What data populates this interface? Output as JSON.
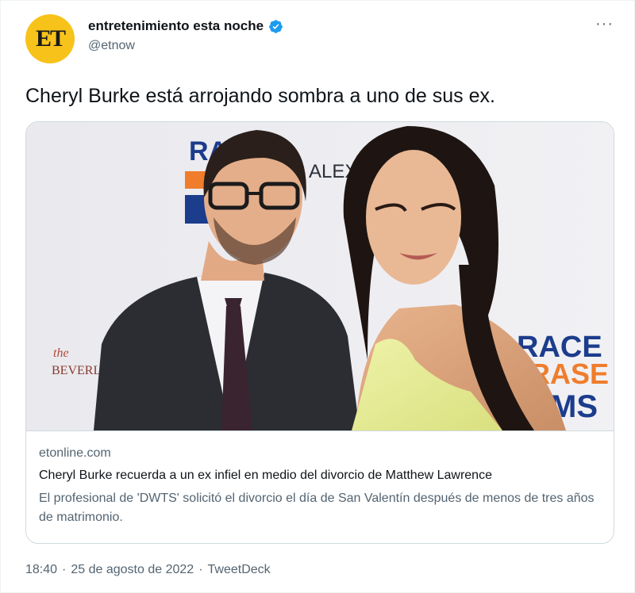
{
  "account": {
    "avatar_text": "ET",
    "display_name": "entretenimiento esta noche",
    "handle": "@etnow"
  },
  "tweet": {
    "text": "Cheryl Burke está arrojando sombra a uno de sus ex.",
    "more_label": "···"
  },
  "card": {
    "image_text": {
      "backdrop_left": "RACE",
      "backdrop_alex": "ALEX",
      "backdrop_right_1": "RACE",
      "backdrop_right_2": "ERASE",
      "backdrop_right_3": "MS",
      "beverly_the": "the",
      "beverly_name": "BEVERLY"
    },
    "domain": "etonline.com",
    "title": "Cheryl Burke recuerda a un ex infiel en medio del divorcio de Matthew Lawrence",
    "description": "El profesional de 'DWTS' solicitó el divorcio el día de San Valentín después de menos de tres años de matrimonio."
  },
  "footer": {
    "time": "18:40",
    "separator1": "·",
    "date": "25 de agosto de 2022",
    "separator2": "·",
    "app": "TweetDeck"
  },
  "colors": {
    "avatar_bg": "#f7c21a",
    "verified": "#1d9bf0",
    "secondary_text": "#536471",
    "dress": "#e6ec9a",
    "race_blue": "#1c3c8c",
    "race_orange": "#ef7d2b"
  }
}
